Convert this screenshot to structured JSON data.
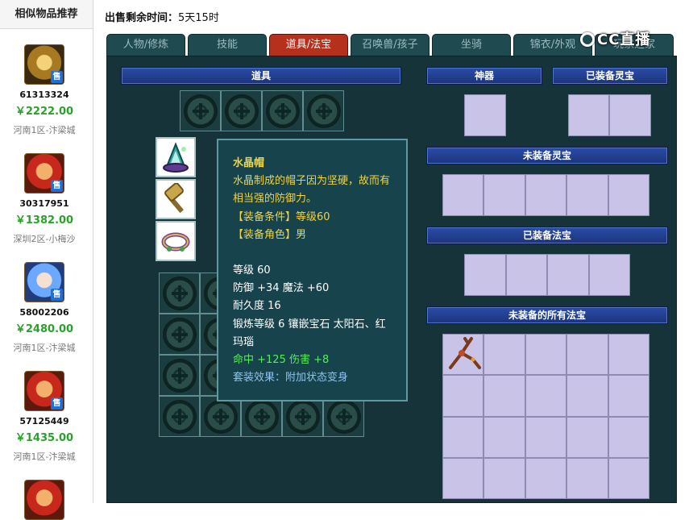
{
  "sidebar": {
    "title": "相似物品推荐",
    "sell_badge": "售",
    "items": [
      {
        "id": "61313324",
        "price": "￥2222.00",
        "server": "河南1区-汴梁城",
        "avatar": "gold"
      },
      {
        "id": "30317951",
        "price": "￥1382.00",
        "server": "深圳2区-小梅沙",
        "avatar": "red"
      },
      {
        "id": "58002206",
        "price": "￥2480.00",
        "server": "河南1区-汴梁城",
        "avatar": "blue"
      },
      {
        "id": "57125449",
        "price": "￥1435.00",
        "server": "河南1区-汴梁城",
        "avatar": "red"
      }
    ]
  },
  "header": {
    "time_label": "出售剩余时间：",
    "time_value": "5天15时",
    "logo": "CC直播"
  },
  "tabs": [
    "人物/修炼",
    "技能",
    "道具/法宝",
    "召唤兽/孩子",
    "坐骑",
    "锦衣/外观",
    "玩家之家"
  ],
  "active_tab": "道具/法宝",
  "sections": {
    "items": "道具",
    "artifact": "神器",
    "equipped_spirit": "已装备灵宝",
    "unequipped_spirit": "未装备灵宝",
    "equipped_magic": "已装备法宝",
    "unequipped_magic": "未装备的所有法宝"
  },
  "tooltip": {
    "name": "水晶帽",
    "desc": "水晶制成的帽子因为坚硬，故而有相当强的防御力。",
    "requirement": "【装备条件】等级60",
    "role": "【装备角色】男",
    "level": "等级 60",
    "defense": "防御 +34 魔法 +60",
    "durability": "耐久度 16",
    "forge": "锻炼等级 6 镶嵌宝石 太阳石、红玛瑙",
    "bonus": "命中 +125 伤害 +8",
    "set_effect": "套装效果：附加状态变身"
  },
  "icons": {
    "slot": "circle-emblem-icon",
    "equip": [
      "crystal-hat-icon",
      "hammer-icon",
      "ring-icon"
    ],
    "magic": "antler-branch-icon"
  }
}
